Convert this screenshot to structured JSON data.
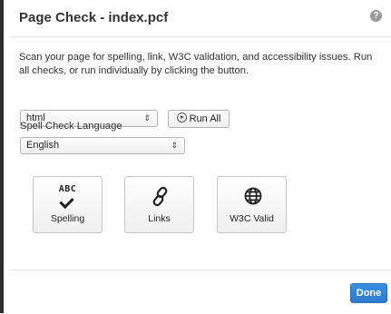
{
  "dialog": {
    "title": "Page Check - index.pcf",
    "help_icon": "?",
    "description": "Scan your page for spelling, link, W3C validation, and accessibility issues. Run all checks, or run individually by clicking the button."
  },
  "format_select": {
    "value": "html",
    "arrows": "⇕"
  },
  "run_all": {
    "label": "Run All"
  },
  "spell_check": {
    "label": "Spell Check Language",
    "value": "English",
    "arrows": "⇕"
  },
  "checks": {
    "spelling": {
      "label": "Spelling",
      "icon": "abc-check-icon",
      "icon_text": "ABC"
    },
    "links": {
      "label": "Links",
      "icon": "chain-link-icon"
    },
    "w3c": {
      "label": "W3C Valid",
      "icon": "globe-icon"
    }
  },
  "footer": {
    "done_label": "Done"
  },
  "colors": {
    "primary_button": "#2f79cf"
  }
}
